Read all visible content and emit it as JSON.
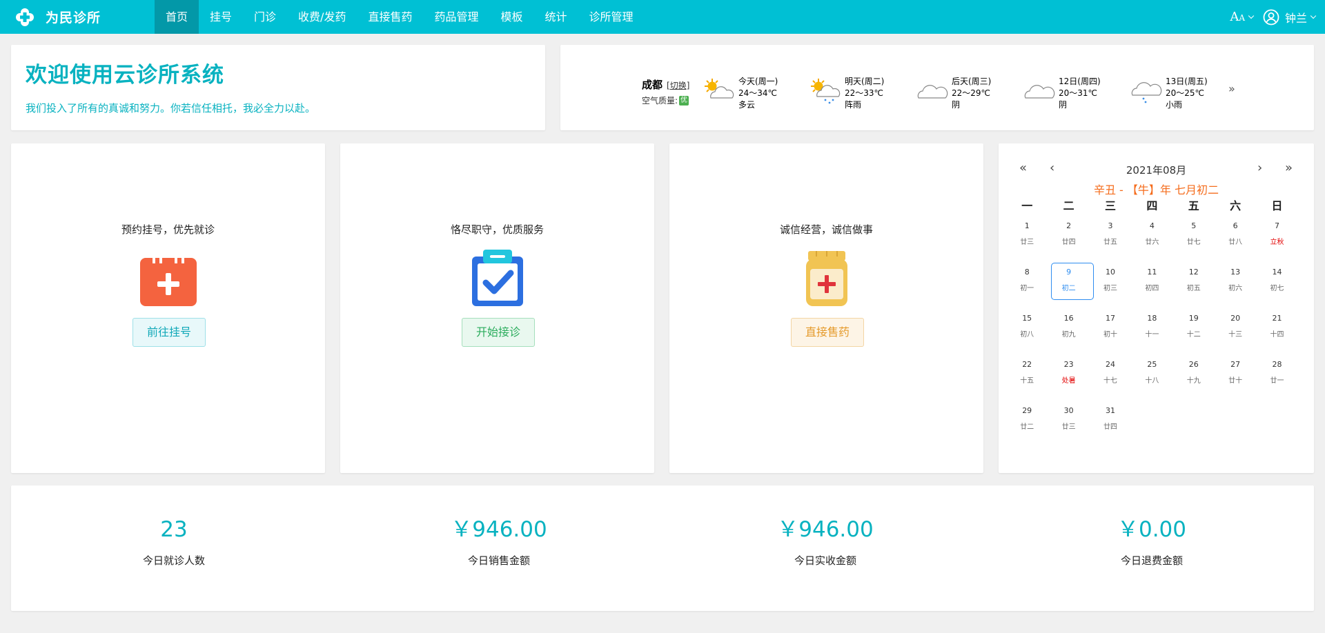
{
  "brand": {
    "name": "为民诊所",
    "logo_icon": "clinic-cross-logo"
  },
  "nav": {
    "items": [
      {
        "label": "首页",
        "active": true
      },
      {
        "label": "挂号"
      },
      {
        "label": "门诊"
      },
      {
        "label": "收费/发药"
      },
      {
        "label": "直接售药"
      },
      {
        "label": "药品管理"
      },
      {
        "label": "模板"
      },
      {
        "label": "统计"
      },
      {
        "label": "诊所管理"
      }
    ]
  },
  "header": {
    "font_tool_big": "A",
    "font_tool_small": "A",
    "user_name": "钟兰"
  },
  "welcome": {
    "title": "欢迎使用云诊所系统",
    "subtitle": "我们投入了所有的真诚和努力。你若信任相托，我必全力以赴。"
  },
  "weather": {
    "city": "成都",
    "switch_label": "[切换]",
    "air_quality_label": "空气质量:",
    "air_quality_value": "优",
    "days": [
      {
        "day": "今天(周一)",
        "temp": "24～34℃",
        "desc": "多云",
        "icon": "sun-cloud-icon"
      },
      {
        "day": "明天(周二)",
        "temp": "22～33℃",
        "desc": "阵雨",
        "icon": "sun-cloud-rain-icon"
      },
      {
        "day": "后天(周三)",
        "temp": "22～29℃",
        "desc": "阴",
        "icon": "cloud-icon"
      },
      {
        "day": "12日(周四)",
        "temp": "20～31℃",
        "desc": "阴",
        "icon": "cloud-icon"
      },
      {
        "day": "13日(周五)",
        "temp": "20～25℃",
        "desc": "小雨",
        "icon": "cloud-rain-icon"
      }
    ],
    "more": "»"
  },
  "features": [
    {
      "slogan": "预约挂号，优先就诊",
      "button": "前往挂号",
      "icon": "calendar-add-icon"
    },
    {
      "slogan": "恪尽职守，优质服务",
      "button": "开始接诊",
      "icon": "clipboard-check-icon"
    },
    {
      "slogan": "诚信经营，诚信做事",
      "button": "直接售药",
      "icon": "medicine-bottle-icon"
    }
  ],
  "calendar": {
    "title": "2021年08月",
    "lunar": "辛丑 - 【牛】年 七月初二",
    "prev_year": "«",
    "prev_month": "‹",
    "next_month": "›",
    "next_year": "»",
    "weekdays": [
      "一",
      "二",
      "三",
      "四",
      "五",
      "六",
      "日"
    ],
    "days": [
      {
        "n": "1",
        "l": "廿三"
      },
      {
        "n": "2",
        "l": "廿四"
      },
      {
        "n": "3",
        "l": "廿五"
      },
      {
        "n": "4",
        "l": "廿六"
      },
      {
        "n": "5",
        "l": "廿七"
      },
      {
        "n": "6",
        "l": "廿八"
      },
      {
        "n": "7",
        "l": "立秋",
        "red": true
      },
      {
        "n": "8",
        "l": "初一"
      },
      {
        "n": "9",
        "l": "初二",
        "selected": true
      },
      {
        "n": "10",
        "l": "初三"
      },
      {
        "n": "11",
        "l": "初四"
      },
      {
        "n": "12",
        "l": "初五"
      },
      {
        "n": "13",
        "l": "初六"
      },
      {
        "n": "14",
        "l": "初七"
      },
      {
        "n": "15",
        "l": "初八"
      },
      {
        "n": "16",
        "l": "初九"
      },
      {
        "n": "17",
        "l": "初十"
      },
      {
        "n": "18",
        "l": "十一"
      },
      {
        "n": "19",
        "l": "十二"
      },
      {
        "n": "20",
        "l": "十三"
      },
      {
        "n": "21",
        "l": "十四"
      },
      {
        "n": "22",
        "l": "十五"
      },
      {
        "n": "23",
        "l": "处暑",
        "red": true
      },
      {
        "n": "24",
        "l": "十七"
      },
      {
        "n": "25",
        "l": "十八"
      },
      {
        "n": "26",
        "l": "十九"
      },
      {
        "n": "27",
        "l": "廿十"
      },
      {
        "n": "28",
        "l": "廿一"
      },
      {
        "n": "29",
        "l": "廿二"
      },
      {
        "n": "30",
        "l": "廿三"
      },
      {
        "n": "31",
        "l": "廿四"
      }
    ]
  },
  "stats": [
    {
      "value": "23",
      "label": "今日就诊人数"
    },
    {
      "value": "￥946.00",
      "label": "今日销售金额"
    },
    {
      "value": "￥946.00",
      "label": "今日实收金额"
    },
    {
      "value": "￥0.00",
      "label": "今日退费金额"
    }
  ],
  "colors": {
    "accent": "#00c0d4",
    "nav_active": "#0398a8",
    "lunar": "#f56c1c",
    "solar_term": "#e20000",
    "selected": "#2d8cf0"
  }
}
